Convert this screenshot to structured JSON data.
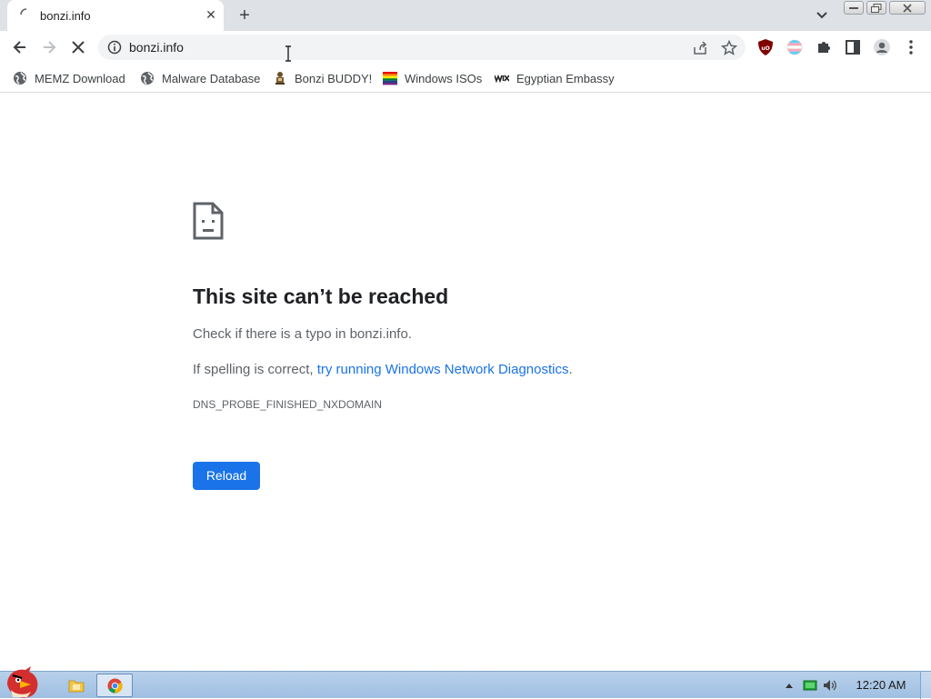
{
  "tab": {
    "title": "bonzi.info"
  },
  "omnibox": {
    "url": "bonzi.info"
  },
  "bookmarks": [
    {
      "label": "MEMZ Download",
      "icon": "globe-icon"
    },
    {
      "label": "Malware Database",
      "icon": "globe-icon"
    },
    {
      "label": "Bonzi BUDDY!",
      "icon": "bonzi-icon"
    },
    {
      "label": "Windows ISOs",
      "icon": "rainbow-flag-icon"
    },
    {
      "label": "Egyptian Embassy",
      "icon": "wix-icon"
    }
  ],
  "error": {
    "title": "This site can’t be reached",
    "line1": "Check if there is a typo in bonzi.info.",
    "line2_prefix": "If spelling is correct, ",
    "line2_link": "try running Windows Network Diagnostics",
    "line2_suffix": ".",
    "code": "DNS_PROBE_FINISHED_NXDOMAIN",
    "reload_label": "Reload"
  },
  "taskbar": {
    "clock": "12:20 AM"
  },
  "colors": {
    "accent": "#1a73e8",
    "tabstrip": "#dee1e6",
    "taskbar": "#a8c6e6"
  }
}
